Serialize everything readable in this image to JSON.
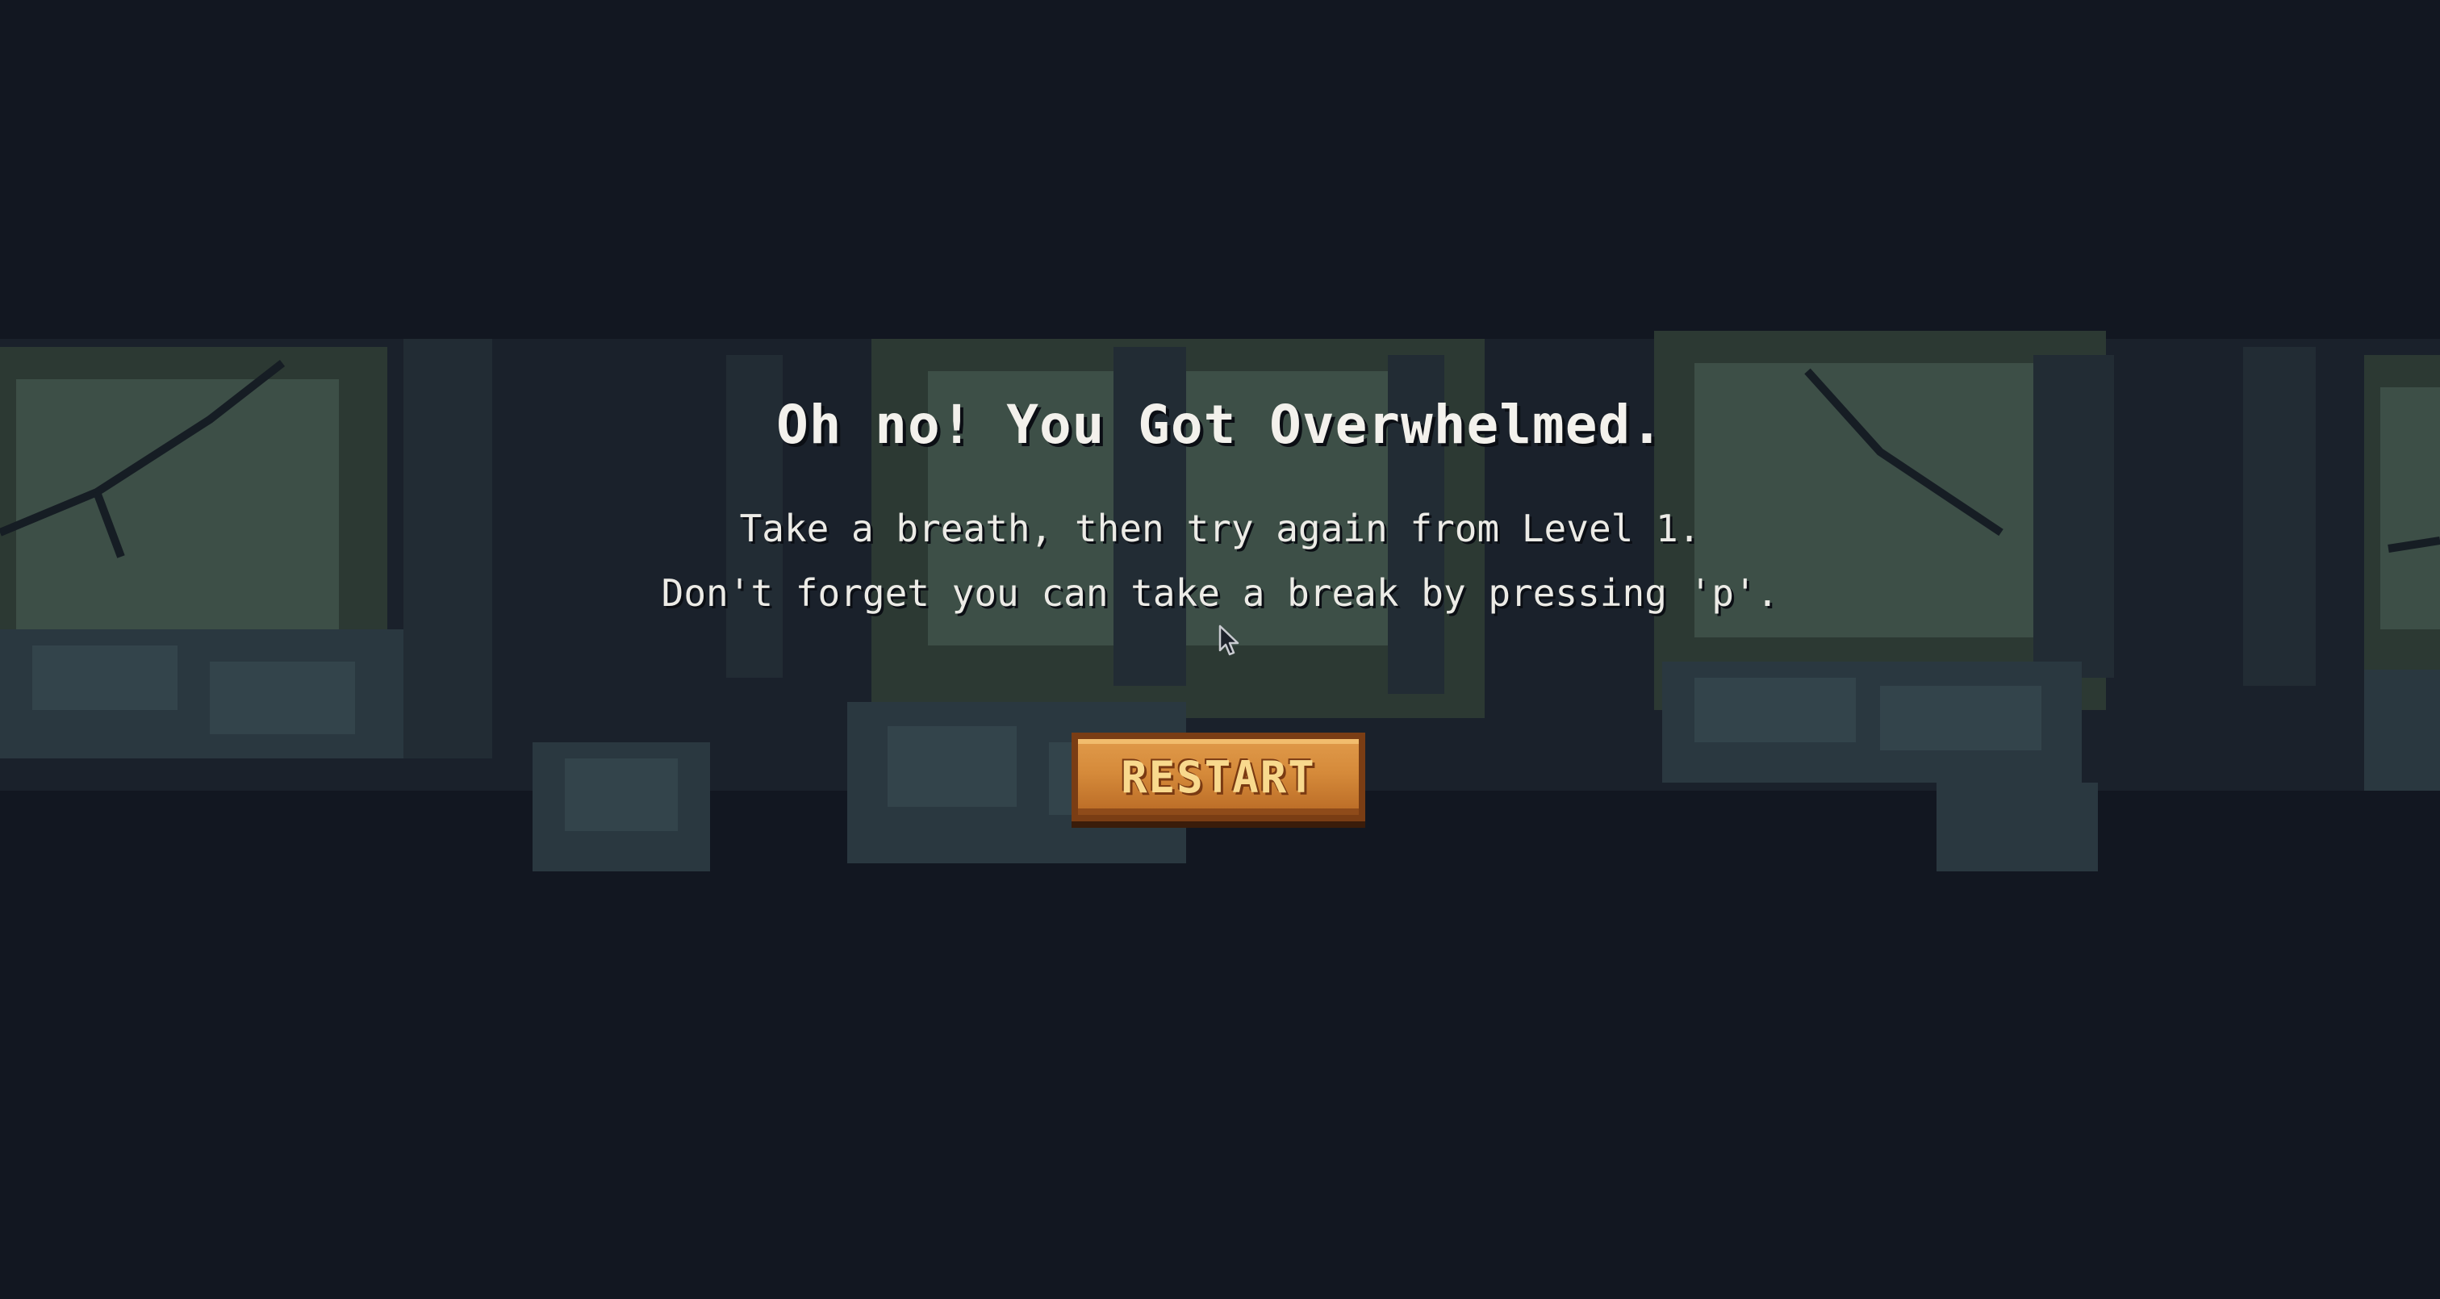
{
  "game_over": {
    "title": "Oh no! You Got Overwhelmed.",
    "line1": "Take a breath, then try again from Level 1.",
    "line2": "Don't forget you can take a break by pressing 'p'.",
    "restart_label": "RESTART"
  },
  "colors": {
    "background": "#121721",
    "foliage": "#3a4a43",
    "button": "#d58a3a",
    "button_text": "#f8d98d"
  },
  "icons": {
    "cursor": "mouse-pointer-icon"
  }
}
